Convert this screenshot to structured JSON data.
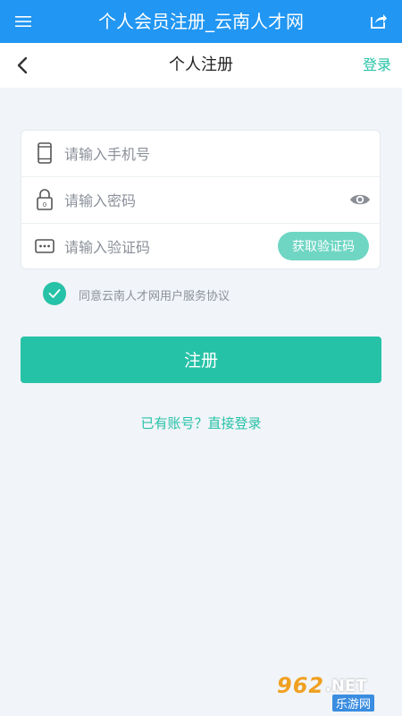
{
  "app": {
    "title": "个人会员注册_云南人才网"
  },
  "nav": {
    "page_title": "个人注册",
    "login_label": "登录"
  },
  "form": {
    "phone_placeholder": "请输入手机号",
    "password_placeholder": "请输入密码",
    "code_placeholder": "请输入验证码",
    "get_code_label": "获取验证码"
  },
  "agreement": {
    "checked": true,
    "text": "同意云南人才网用户服务协议"
  },
  "actions": {
    "register_label": "注册",
    "already_label": "已有账号？直接登录"
  },
  "watermark": {
    "number": "962",
    "net": ".NET",
    "cn": "乐游网"
  },
  "colors": {
    "header_bg": "#2196f3",
    "accent": "#26c2a7",
    "page_bg": "#f1f4f8"
  }
}
